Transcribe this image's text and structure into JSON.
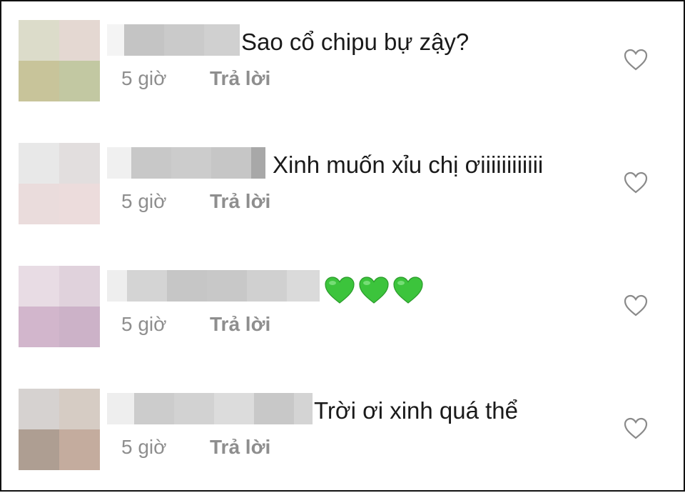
{
  "comments": [
    {
      "text": "Sao cổ chipu bự zậy?",
      "time": "5 giờ",
      "reply_label": "Trả lời",
      "avatar_colors": [
        "#dcdcca",
        "#e4d8d2",
        "#c8c49a",
        "#c2c8a2"
      ]
    },
    {
      "text": "Xinh muốn xỉu chị ơiiiiiiiiiiii",
      "time": "5 giờ",
      "reply_label": "Trả lời",
      "avatar_colors": [
        "#e8e8e8",
        "#e2dede",
        "#eadcdc",
        "#ecdcdc"
      ]
    },
    {
      "text": "",
      "emojis": [
        "green-heart",
        "green-heart",
        "green-heart"
      ],
      "time": "5 giờ",
      "reply_label": "Trả lời",
      "avatar_colors": [
        "#e8dce4",
        "#e0d2dc",
        "#d2b6cc",
        "#ccb2c8"
      ]
    },
    {
      "text": "Trời ơi xinh quá thể",
      "time": "5 giờ",
      "reply_label": "Trả lời",
      "avatar_colors": [
        "#d6d2d0",
        "#d6ccc4",
        "#ae9e92",
        "#c4ac9e"
      ]
    }
  ],
  "icons": {
    "like": "heart-outline-icon",
    "emoji": "green-heart-emoji"
  },
  "colors": {
    "text": "#1a1a1a",
    "meta": "#8e8e8e",
    "border": "#111111",
    "emoji_green": "#3cc43c"
  }
}
